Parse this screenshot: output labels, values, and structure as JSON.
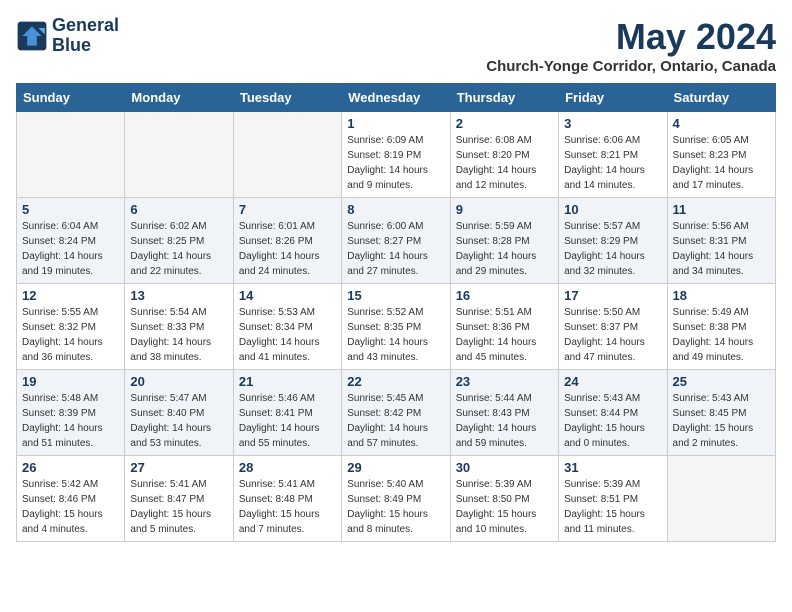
{
  "logo": {
    "line1": "General",
    "line2": "Blue"
  },
  "title": "May 2024",
  "location": "Church-Yonge Corridor, Ontario, Canada",
  "days_of_week": [
    "Sunday",
    "Monday",
    "Tuesday",
    "Wednesday",
    "Thursday",
    "Friday",
    "Saturday"
  ],
  "weeks": [
    [
      {
        "day": "",
        "empty": true
      },
      {
        "day": "",
        "empty": true
      },
      {
        "day": "",
        "empty": true
      },
      {
        "day": "1",
        "sunrise": "6:09 AM",
        "sunset": "8:19 PM",
        "daylight": "14 hours and 9 minutes."
      },
      {
        "day": "2",
        "sunrise": "6:08 AM",
        "sunset": "8:20 PM",
        "daylight": "14 hours and 12 minutes."
      },
      {
        "day": "3",
        "sunrise": "6:06 AM",
        "sunset": "8:21 PM",
        "daylight": "14 hours and 14 minutes."
      },
      {
        "day": "4",
        "sunrise": "6:05 AM",
        "sunset": "8:23 PM",
        "daylight": "14 hours and 17 minutes."
      }
    ],
    [
      {
        "day": "5",
        "sunrise": "6:04 AM",
        "sunset": "8:24 PM",
        "daylight": "14 hours and 19 minutes."
      },
      {
        "day": "6",
        "sunrise": "6:02 AM",
        "sunset": "8:25 PM",
        "daylight": "14 hours and 22 minutes."
      },
      {
        "day": "7",
        "sunrise": "6:01 AM",
        "sunset": "8:26 PM",
        "daylight": "14 hours and 24 minutes."
      },
      {
        "day": "8",
        "sunrise": "6:00 AM",
        "sunset": "8:27 PM",
        "daylight": "14 hours and 27 minutes."
      },
      {
        "day": "9",
        "sunrise": "5:59 AM",
        "sunset": "8:28 PM",
        "daylight": "14 hours and 29 minutes."
      },
      {
        "day": "10",
        "sunrise": "5:57 AM",
        "sunset": "8:29 PM",
        "daylight": "14 hours and 32 minutes."
      },
      {
        "day": "11",
        "sunrise": "5:56 AM",
        "sunset": "8:31 PM",
        "daylight": "14 hours and 34 minutes."
      }
    ],
    [
      {
        "day": "12",
        "sunrise": "5:55 AM",
        "sunset": "8:32 PM",
        "daylight": "14 hours and 36 minutes."
      },
      {
        "day": "13",
        "sunrise": "5:54 AM",
        "sunset": "8:33 PM",
        "daylight": "14 hours and 38 minutes."
      },
      {
        "day": "14",
        "sunrise": "5:53 AM",
        "sunset": "8:34 PM",
        "daylight": "14 hours and 41 minutes."
      },
      {
        "day": "15",
        "sunrise": "5:52 AM",
        "sunset": "8:35 PM",
        "daylight": "14 hours and 43 minutes."
      },
      {
        "day": "16",
        "sunrise": "5:51 AM",
        "sunset": "8:36 PM",
        "daylight": "14 hours and 45 minutes."
      },
      {
        "day": "17",
        "sunrise": "5:50 AM",
        "sunset": "8:37 PM",
        "daylight": "14 hours and 47 minutes."
      },
      {
        "day": "18",
        "sunrise": "5:49 AM",
        "sunset": "8:38 PM",
        "daylight": "14 hours and 49 minutes."
      }
    ],
    [
      {
        "day": "19",
        "sunrise": "5:48 AM",
        "sunset": "8:39 PM",
        "daylight": "14 hours and 51 minutes."
      },
      {
        "day": "20",
        "sunrise": "5:47 AM",
        "sunset": "8:40 PM",
        "daylight": "14 hours and 53 minutes."
      },
      {
        "day": "21",
        "sunrise": "5:46 AM",
        "sunset": "8:41 PM",
        "daylight": "14 hours and 55 minutes."
      },
      {
        "day": "22",
        "sunrise": "5:45 AM",
        "sunset": "8:42 PM",
        "daylight": "14 hours and 57 minutes."
      },
      {
        "day": "23",
        "sunrise": "5:44 AM",
        "sunset": "8:43 PM",
        "daylight": "14 hours and 59 minutes."
      },
      {
        "day": "24",
        "sunrise": "5:43 AM",
        "sunset": "8:44 PM",
        "daylight": "15 hours and 0 minutes."
      },
      {
        "day": "25",
        "sunrise": "5:43 AM",
        "sunset": "8:45 PM",
        "daylight": "15 hours and 2 minutes."
      }
    ],
    [
      {
        "day": "26",
        "sunrise": "5:42 AM",
        "sunset": "8:46 PM",
        "daylight": "15 hours and 4 minutes."
      },
      {
        "day": "27",
        "sunrise": "5:41 AM",
        "sunset": "8:47 PM",
        "daylight": "15 hours and 5 minutes."
      },
      {
        "day": "28",
        "sunrise": "5:41 AM",
        "sunset": "8:48 PM",
        "daylight": "15 hours and 7 minutes."
      },
      {
        "day": "29",
        "sunrise": "5:40 AM",
        "sunset": "8:49 PM",
        "daylight": "15 hours and 8 minutes."
      },
      {
        "day": "30",
        "sunrise": "5:39 AM",
        "sunset": "8:50 PM",
        "daylight": "15 hours and 10 minutes."
      },
      {
        "day": "31",
        "sunrise": "5:39 AM",
        "sunset": "8:51 PM",
        "daylight": "15 hours and 11 minutes."
      },
      {
        "day": "",
        "empty": true
      }
    ]
  ]
}
